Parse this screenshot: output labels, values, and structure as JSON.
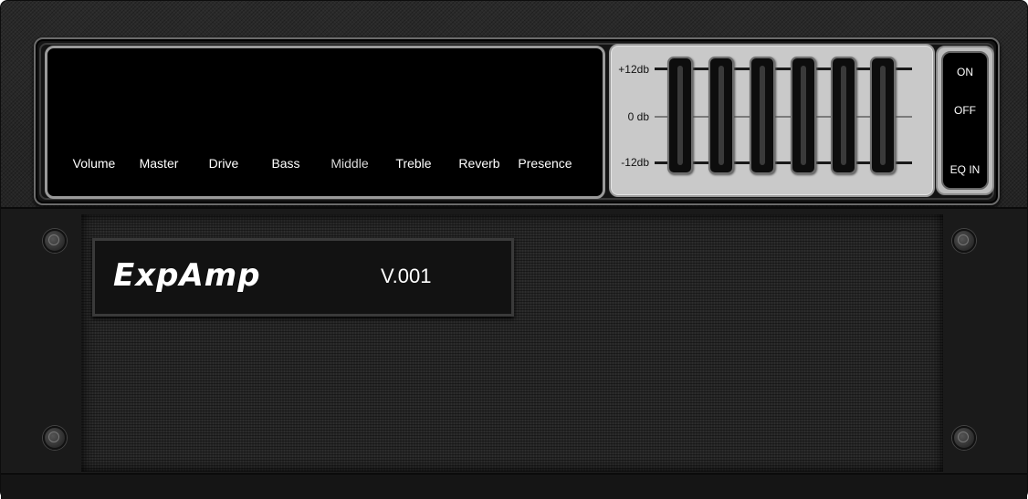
{
  "controls": {
    "knobs": [
      {
        "label": "Volume"
      },
      {
        "label": "Master"
      },
      {
        "label": "Drive"
      },
      {
        "label": "Bass"
      },
      {
        "label": "Middle"
      },
      {
        "label": "Treble"
      },
      {
        "label": "Reverb"
      },
      {
        "label": "Presence"
      }
    ]
  },
  "eq": {
    "labels": {
      "top": "+12db",
      "mid": "0 db",
      "bottom": "-12db"
    },
    "band_count": 6
  },
  "eq_switch": {
    "on": "ON",
    "off": "OFF",
    "eq_in": "EQ IN"
  },
  "brand": {
    "logo": "ExpAmp",
    "version": "V.001"
  }
}
